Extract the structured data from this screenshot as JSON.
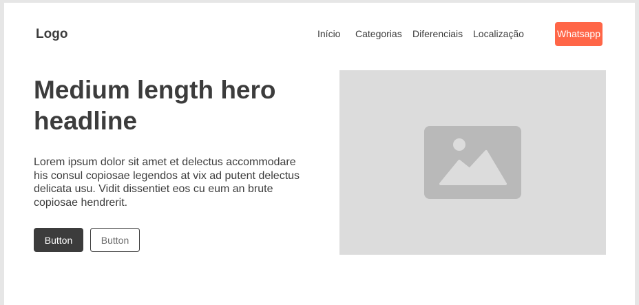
{
  "header": {
    "logo": "Logo",
    "nav": [
      {
        "label": "Início"
      },
      {
        "label": "Categorias"
      },
      {
        "label": "Diferenciais"
      },
      {
        "label": "Localização"
      }
    ],
    "cta_label": "Whatsapp"
  },
  "hero": {
    "title": "Medium length hero headline",
    "text": "Lorem ipsum dolor sit amet et delectus accommodare his consul copiosae legendos at vix ad putent delectus delicata usu. Vidit dissentiet eos cu eum an brute copiosae hendrerit.",
    "primary_button": "Button",
    "secondary_button": "Button",
    "image_icon": "image-placeholder-icon"
  },
  "colors": {
    "accent": "#ff6647",
    "text": "#3c3c3c",
    "image_bg": "#dcdcdc",
    "icon": "#b9b9b9"
  }
}
